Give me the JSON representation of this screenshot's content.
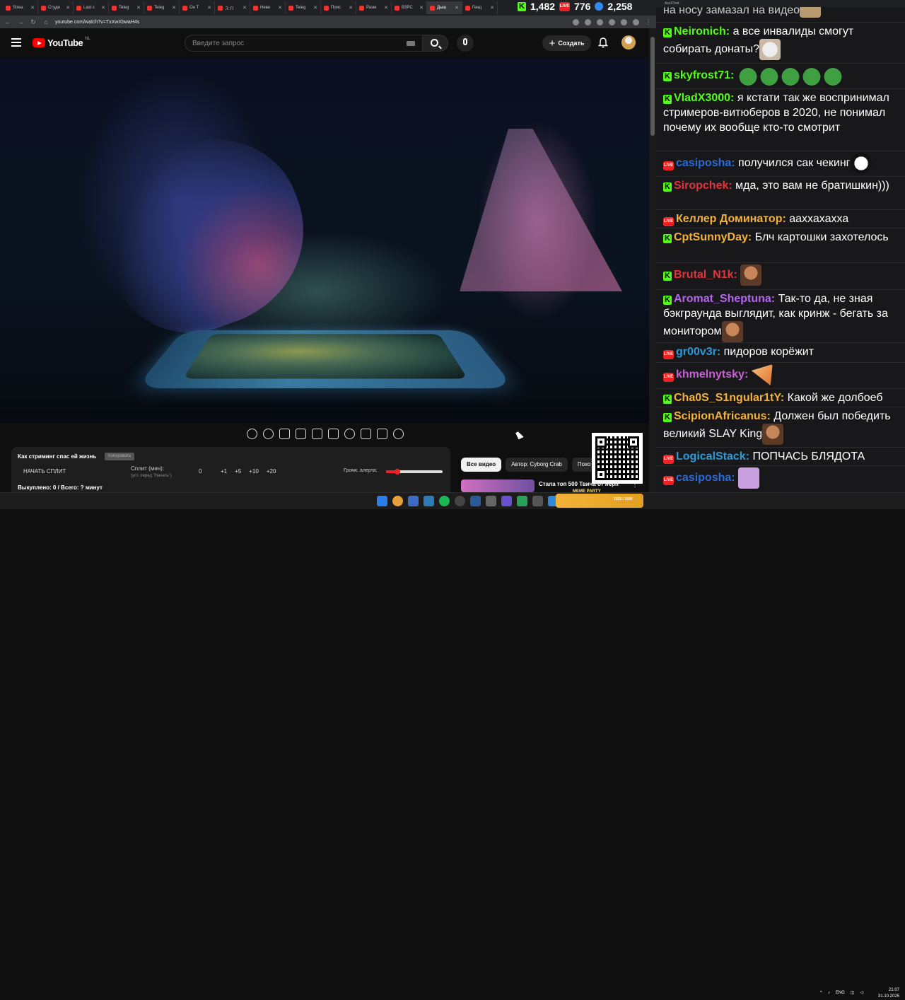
{
  "browser": {
    "tabs": [
      {
        "label": "Strea"
      },
      {
        "label": "Студи"
      },
      {
        "label": "Last c"
      },
      {
        "label": "Teleg"
      },
      {
        "label": "Teleg"
      },
      {
        "label": "Он Т"
      },
      {
        "label": "ス ГІ"
      },
      {
        "label": "Неве"
      },
      {
        "label": "Teleg"
      },
      {
        "label": "Поис"
      },
      {
        "label": "Разм"
      },
      {
        "label": "ВЗРС"
      },
      {
        "label": "Дыш"
      },
      {
        "label": "Генд"
      }
    ],
    "url": "youtube.com/watch?v=TxXwXbwaH4s"
  },
  "overlay_counters": {
    "kick": "1,482",
    "live": "776",
    "viewers": "2,258"
  },
  "youtube": {
    "logo_text": "YouTube",
    "region": "NL",
    "search_placeholder": "Введите запрос",
    "create_label": "Создать"
  },
  "extension": {
    "title": "Как стриминг спас ей жизнь",
    "copy_label": "Копировать",
    "split_button": "НАЧАТЬ СПЛИТ",
    "split_label": "Сплит (мин):",
    "split_hint": "(уст. перед \"Начать\")",
    "split_value": "0",
    "steps": [
      "+1",
      "+5",
      "+10",
      "+20"
    ],
    "volume_label": "Громк. алерта:",
    "volume_fraction": 0.2,
    "stats": "Выкуплено: 0 / Всего: ? минут"
  },
  "chips": [
    {
      "label": "Все видео",
      "selected": true
    },
    {
      "label": "Автор: Cyborg Crab",
      "selected": false
    },
    {
      "label": "Похо",
      "selected": false
    }
  ],
  "recommendation": {
    "title": "Стала топ 500 Твича от нерп"
  },
  "chat": {
    "window_title": "AxelChat",
    "top_partial": "на носу замазал на видео",
    "messages": [
      {
        "platform": "kick",
        "nick": "Neironich:",
        "color": "#53fc18",
        "text": "а все инвалиды смогут собирать донаты?",
        "emote": "cat"
      },
      {
        "platform": "kick",
        "nick": "skyfrost71:",
        "color": "#53fc18",
        "text": "",
        "emote": "frog-x5"
      },
      {
        "platform": "kick",
        "nick": "VladX3000:",
        "color": "#53fc18",
        "text": "я кстати так же воспринимал стримеров-витюберов в 2020, не понимал почему их вообще кто-то смотрит",
        "emote": ""
      },
      {
        "platform": "live",
        "nick": "casiposha:",
        "color": "#2d6ad6",
        "text": "получился сак чекинг",
        "emote": "mask"
      },
      {
        "platform": "kick",
        "nick": "Siropchek:",
        "color": "#e5333b",
        "text": "мда, это вам не братишкин)))",
        "emote": ""
      },
      {
        "platform": "live",
        "nick": "Келлер Доминатор:",
        "color": "#f4b23a",
        "text": "ааххахахха",
        "emote": ""
      },
      {
        "platform": "kick",
        "nick": "CptSunnyDay:",
        "color": "#f4b23a",
        "text": "Блч картошки захотелось",
        "emote": ""
      },
      {
        "platform": "kick",
        "nick": "Brutal_N1k:",
        "color": "#e5333b",
        "text": "",
        "emote": "face"
      },
      {
        "platform": "kick",
        "nick": "Aromat_Sheptuna:",
        "color": "#b565f0",
        "text": "Так-то да, не зная бэкграунда выглядит, как кринж - бегать за монитором",
        "emote": "face"
      },
      {
        "platform": "live",
        "nick": "gr00v3r:",
        "color": "#2d9ad6",
        "text": "пидоров корёжит",
        "emote": ""
      },
      {
        "platform": "live",
        "nick": "khmelnytsky:",
        "color": "#c861d6",
        "text": "",
        "emote": "pizza"
      },
      {
        "platform": "kick",
        "nick": "Cha0S_S1ngular1tY:",
        "color": "#f4b23a",
        "text": "Какой же долбоеб",
        "emote": ""
      },
      {
        "platform": "kick",
        "nick": "ScipionAfricanus:",
        "color": "#f4b23a",
        "text": "Должен был победить великий SLAY King",
        "emote": "face"
      },
      {
        "platform": "live",
        "nick": "LogicalStack:",
        "color": "#2d9ad6",
        "text": "ПОПЧАСЬ БЛЯДОТА",
        "emote": ""
      },
      {
        "platform": "live",
        "nick": "casiposha:",
        "color": "#2d6ad6",
        "text": "",
        "emote": "pink"
      }
    ]
  },
  "taskbar": {
    "meme_label": "MEME PARTY",
    "meme_count": "1025 / 1500",
    "lang": "ENG",
    "time": "21:07",
    "date": "31.10.2025"
  },
  "colors": {
    "kick": "#53fc18",
    "live": "#e22222",
    "youtube_red": "#ff0000",
    "chat_bg": "#18181b"
  }
}
